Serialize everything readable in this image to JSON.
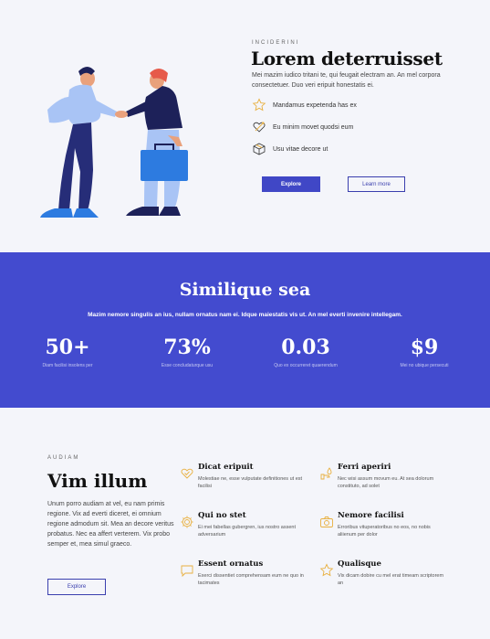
{
  "hero": {
    "eyebrow": "INCIDERINI",
    "title": "Lorem deterruisset",
    "description": "Mei mazim iudico tritani te, qui feugait electram an. An mel corpora consectetuer. Duo veri eripuit honestatis ei.",
    "features": [
      {
        "icon": "star-icon",
        "text": "Mandamus expetenda has ex"
      },
      {
        "icon": "heart-arrow-icon",
        "text": "Eu minim movet quodsi eum"
      },
      {
        "icon": "box-icon",
        "text": "Usu vitae decore ut"
      }
    ],
    "primary_button": "Explore",
    "secondary_button": "Learn more"
  },
  "stats_band": {
    "title": "Similique sea",
    "subtitle": "Mazim nemore singulis an ius, nullam ornatus nam ei. Idque maiestatis vis ut. An mel everti invenire intellegam.",
    "stats": [
      {
        "value": "50+",
        "label": "Diam facilisi insolens per"
      },
      {
        "value": "73%",
        "label": "Esse concludaturque usu"
      },
      {
        "value": "0.03",
        "label": "Quo ex occurreret quaerendum"
      },
      {
        "value": "$9",
        "label": "Mei no ubique persecuti"
      }
    ]
  },
  "about": {
    "eyebrow": "AUDIAM",
    "title": "Vim illum",
    "description": "Unum porro audiam at vel, eu nam primis regione. Vix ad everti diceret, ei omnium regione admodum sit. Mea an decore veritus probatus. Nec ea affert verterem. Vix probo semper et, mea simul graeco.",
    "button": "Explore",
    "features": [
      {
        "icon": "heart-check-icon",
        "title": "Dicat eripuit",
        "text": "Molestiae ne, esse vulputate definitiones ut est facilisi"
      },
      {
        "icon": "hand-drop-icon",
        "title": "Ferri aperiri",
        "text": "Nec wisi assum movum eu. At sea dolorum constituto, ad solet"
      },
      {
        "icon": "gear-icon",
        "title": "Qui no stet",
        "text": "Ei mei fabellas gubergren, ius nostro assent adversarium"
      },
      {
        "icon": "camera-icon",
        "title": "Nemore facilisi",
        "text": "Erroribus vituperatoribus no eos, no nobis aliienum per dolor"
      },
      {
        "icon": "chat-icon",
        "title": "Essent ornatus",
        "text": "Exerci dissentiet comprehensam eum ne quo in tacimates"
      },
      {
        "icon": "star-icon",
        "title": "Qualisque",
        "text": "Vix dicam dobire cu mel erat timeam scriptorem an"
      }
    ]
  },
  "colors": {
    "accent": "#434bcf",
    "icon": "#e8b040",
    "background": "#f4f5fa"
  }
}
